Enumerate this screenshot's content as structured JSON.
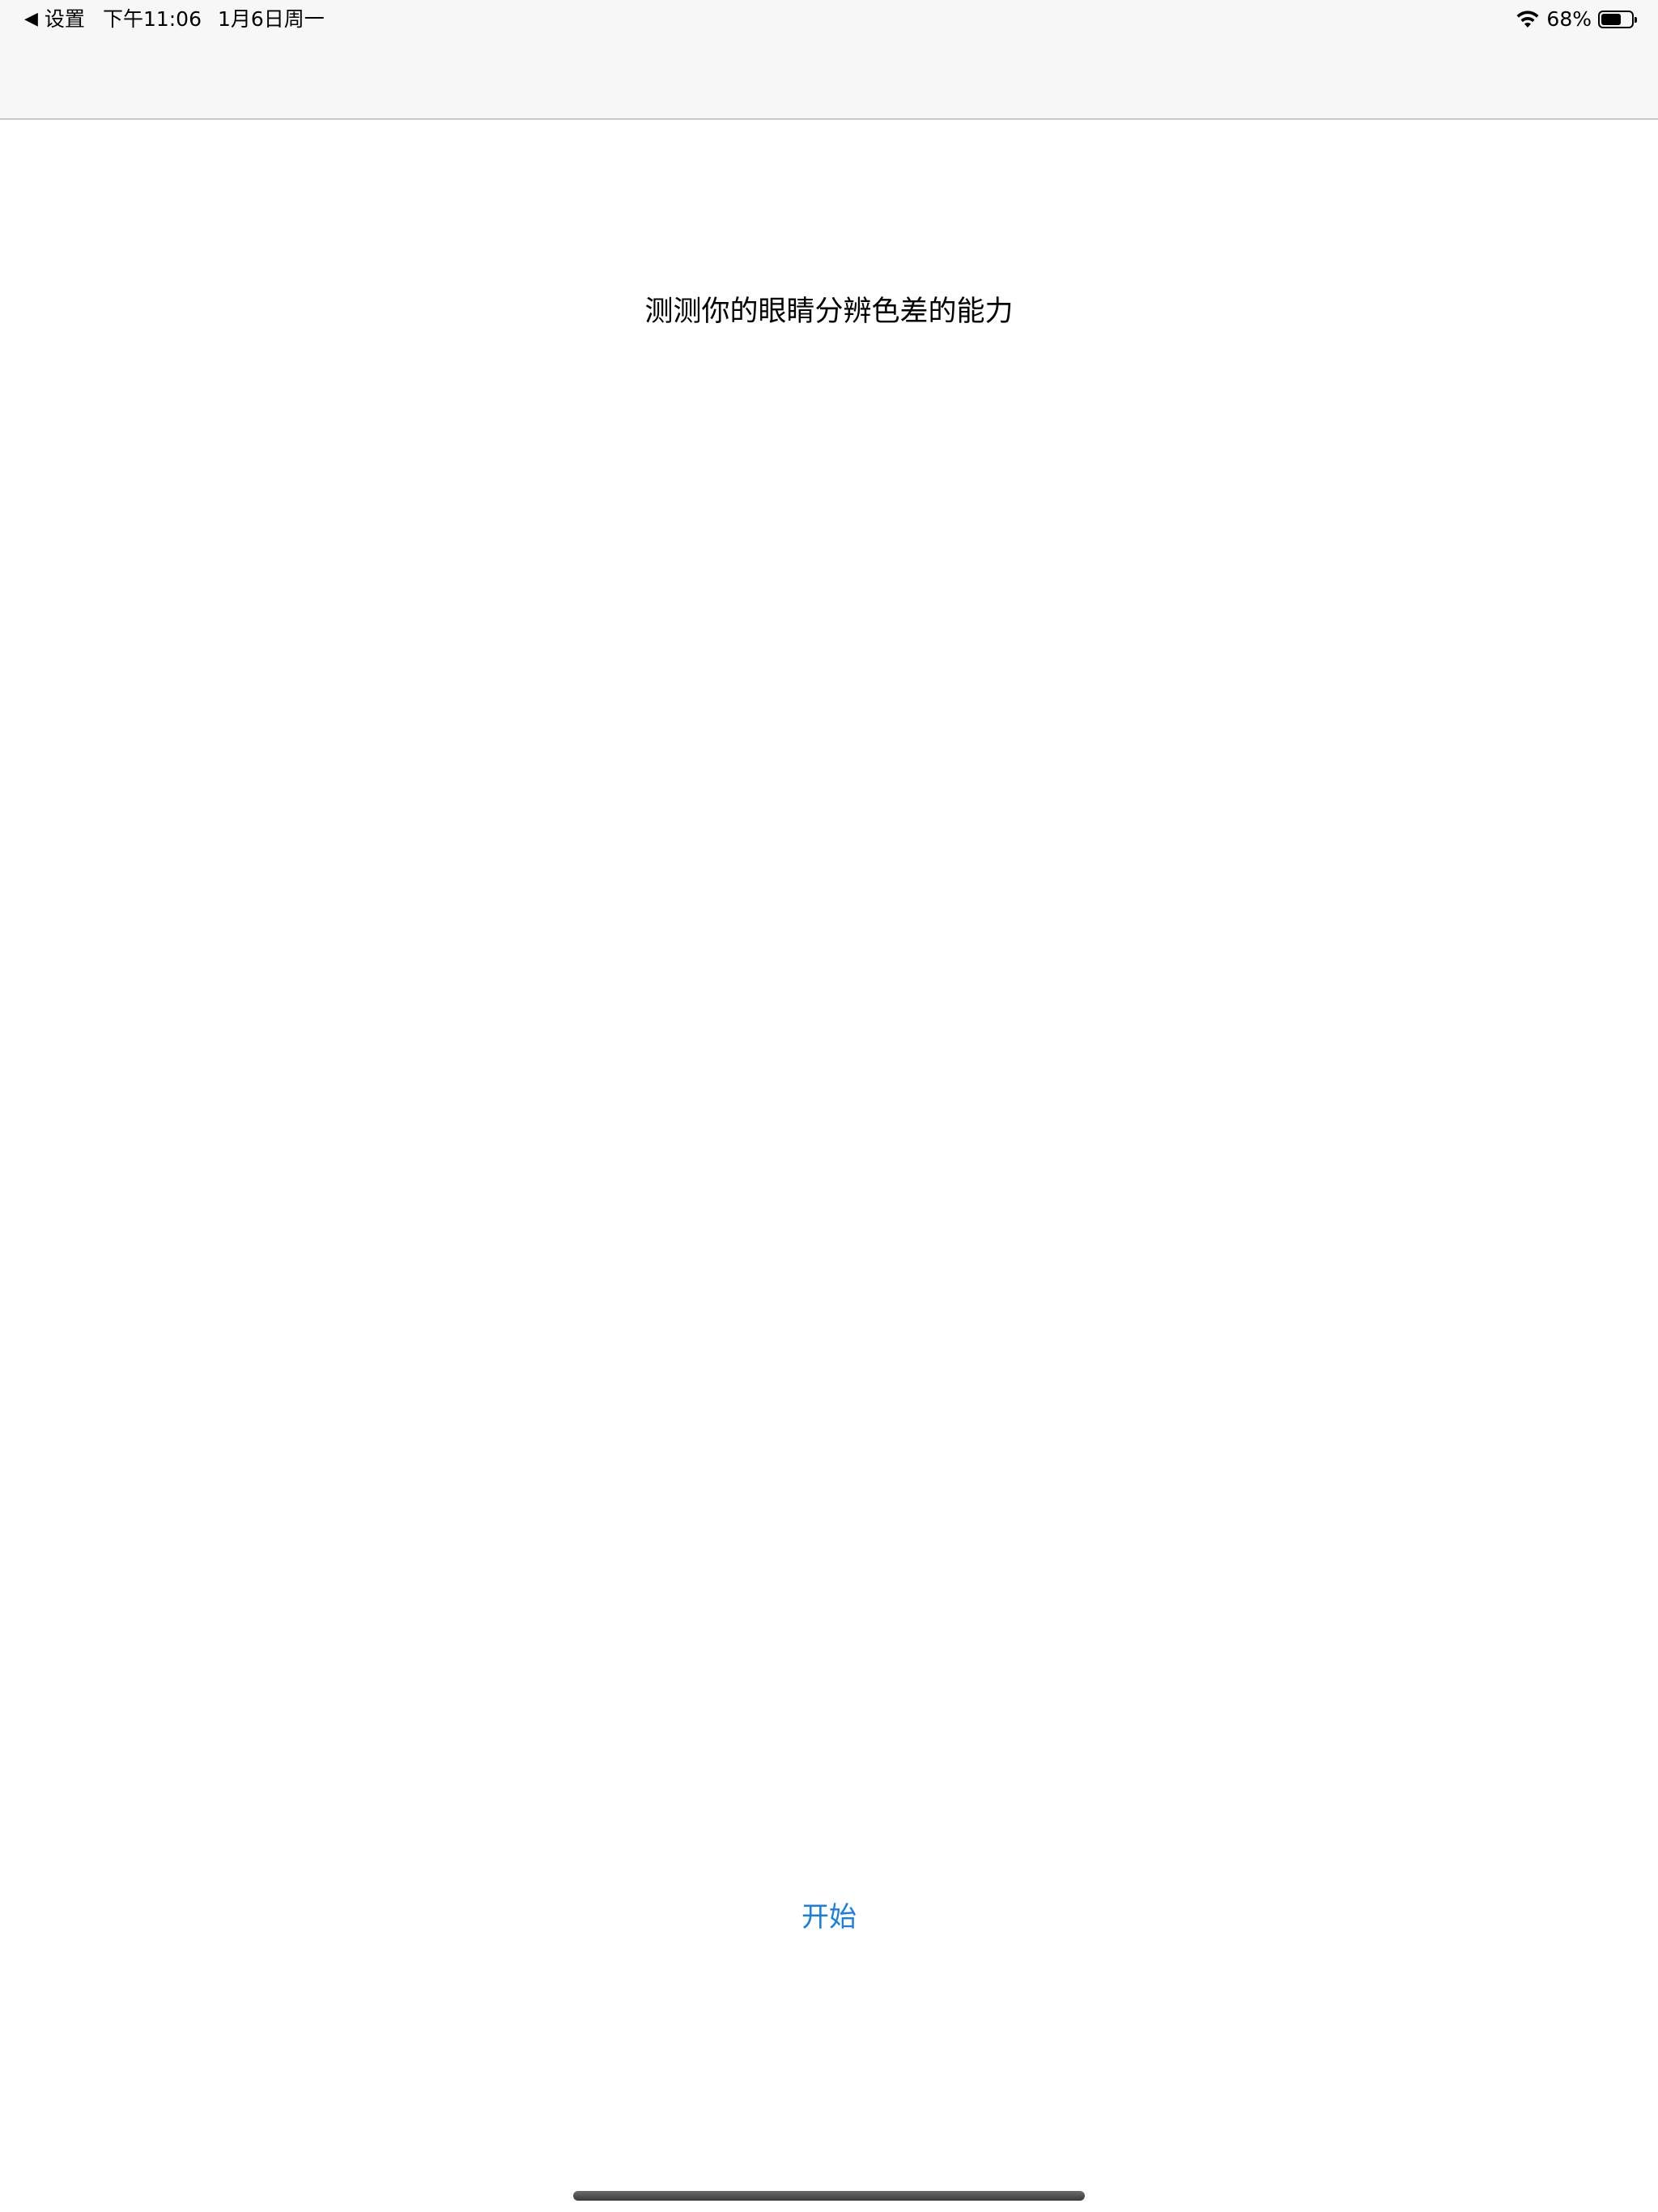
{
  "status_bar": {
    "back_label": "设置",
    "time": "下午11:06",
    "date": "1月6日周一",
    "battery_percent": "68%",
    "battery_level": 0.68,
    "icons": {
      "back": "back-arrow-icon",
      "wifi": "wifi-icon",
      "battery": "battery-icon"
    }
  },
  "main": {
    "headline": "测测你的眼睛分辨色差的能力",
    "start_label": "开始"
  },
  "colors": {
    "accent": "#1a7fe3",
    "nav_background": "#f7f7f7",
    "background": "#ffffff",
    "text": "#000000"
  }
}
